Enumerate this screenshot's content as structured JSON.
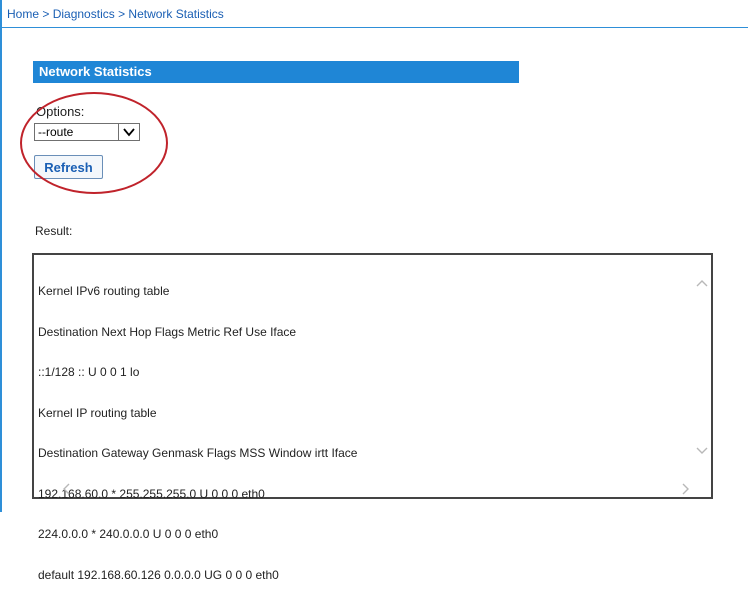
{
  "breadcrumb": {
    "items": [
      "Home",
      "Diagnostics",
      "Network Statistics"
    ],
    "separator": ">"
  },
  "section": {
    "title": "Network Statistics"
  },
  "options": {
    "label": "Options:",
    "selected_value": "--route"
  },
  "refresh_button": {
    "label": "Refresh"
  },
  "result": {
    "label": "Result:",
    "lines": [
      "Kernel IPv6 routing table",
      "Destination Next Hop Flags Metric Ref Use Iface",
      "::1/128 :: U 0 0 1 lo",
      "Kernel IP routing table",
      "Destination Gateway Genmask Flags MSS Window irtt Iface",
      "192.168.60.0 * 255.255.255.0 U 0 0 0 eth0",
      "224.0.0.0 * 240.0.0.0 U 0 0 0 eth0",
      "default 192.168.60.126 0.0.0.0 UG 0 0 0 eth0"
    ]
  },
  "colors": {
    "accent": "#1f86d6",
    "link": "#1a5fb4",
    "annotation": "#c0232b"
  }
}
